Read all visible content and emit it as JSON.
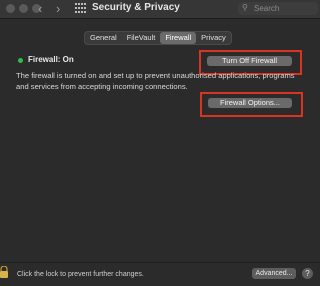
{
  "window": {
    "title": "Security & Privacy"
  },
  "search": {
    "placeholder": "Search"
  },
  "tabs": [
    {
      "label": "General"
    },
    {
      "label": "FileVault"
    },
    {
      "label": "Firewall",
      "active": true
    },
    {
      "label": "Privacy"
    }
  ],
  "firewall": {
    "status": "Firewall: On",
    "status_color": "#2ebd4a",
    "description": "The firewall is turned on and set up to prevent unauthorised applications, programs and services from accepting incoming connections.",
    "turn_off_label": "Turn Off Firewall",
    "options_label": "Firewall Options..."
  },
  "footer": {
    "lock_text": "Click the lock to prevent further changes.",
    "advanced_label": "Advanced...",
    "help_label": "?"
  },
  "highlight_color": "#d8341f"
}
